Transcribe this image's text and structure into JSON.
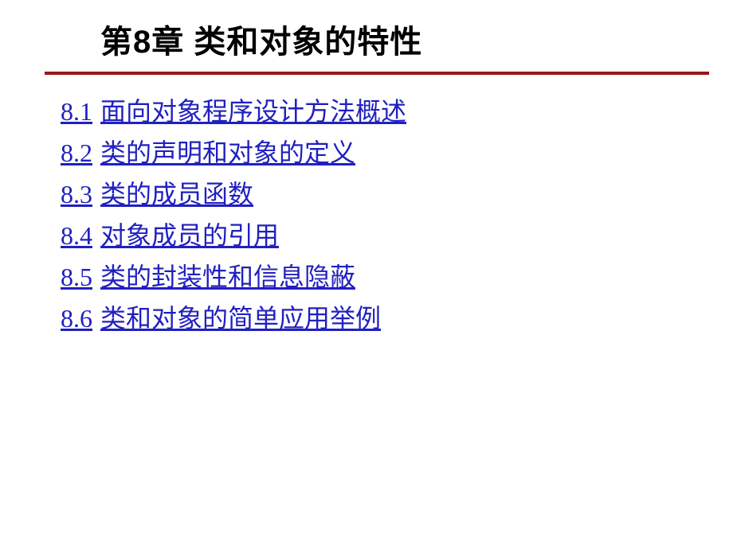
{
  "title": "第8章  类和对象的特性",
  "toc": [
    {
      "num": "8.1",
      "text": "面向对象程序设计方法概述"
    },
    {
      "num": "8.2",
      "text": "类的声明和对象的定义"
    },
    {
      "num": "8.3",
      "text": "类的成员函数"
    },
    {
      "num": "8.4",
      "text": "对象成员的引用"
    },
    {
      "num": "8.5",
      "text": "类的封装性和信息隐蔽"
    },
    {
      "num": "8.6",
      "text": "类和对象的简单应用举例"
    }
  ]
}
